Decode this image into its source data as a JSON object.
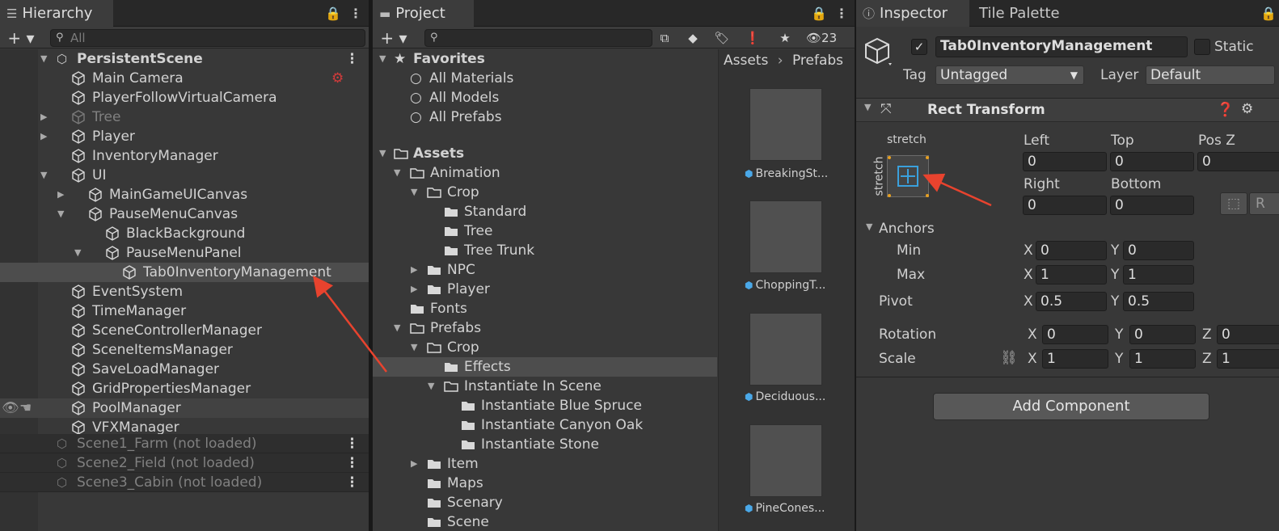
{
  "hierarchy": {
    "tab_label": "Hierarchy",
    "search_placeholder": "All",
    "scene_name": "PersistentScene",
    "items": [
      {
        "label": "Main Camera",
        "depth": 0
      },
      {
        "label": "PlayerFollowVirtualCamera",
        "depth": 0
      },
      {
        "label": "Tree",
        "depth": 0
      },
      {
        "label": "Player",
        "depth": 0
      },
      {
        "label": "InventoryManager",
        "depth": 0
      },
      {
        "label": "UI",
        "depth": 0
      },
      {
        "label": "MainGameUICanvas",
        "depth": 1
      },
      {
        "label": "PauseMenuCanvas",
        "depth": 1
      },
      {
        "label": "BlackBackground",
        "depth": 2
      },
      {
        "label": "PauseMenuPanel",
        "depth": 2
      },
      {
        "label": "Tab0InventoryManagement",
        "depth": 3
      },
      {
        "label": "EventSystem",
        "depth": 0
      },
      {
        "label": "TimeManager",
        "depth": 0
      },
      {
        "label": "SceneControllerManager",
        "depth": 0
      },
      {
        "label": "SceneItemsManager",
        "depth": 0
      },
      {
        "label": "SaveLoadManager",
        "depth": 0
      },
      {
        "label": "GridPropertiesManager",
        "depth": 0
      },
      {
        "label": "PoolManager",
        "depth": 0
      },
      {
        "label": "VFXManager",
        "depth": 0
      }
    ],
    "unloaded_scenes": [
      {
        "label": "Scene1_Farm (not loaded)"
      },
      {
        "label": "Scene2_Field (not loaded)"
      },
      {
        "label": "Scene3_Cabin (not loaded)"
      }
    ]
  },
  "project": {
    "tab_label": "Project",
    "hidden_count": "23",
    "breadcrumb": [
      "Assets",
      "Prefabs"
    ],
    "favorites_label": "Favorites",
    "favorites": [
      {
        "label": "All Materials"
      },
      {
        "label": "All Models"
      },
      {
        "label": "All Prefabs"
      }
    ],
    "assets_label": "Assets",
    "tree": [
      {
        "label": "Animation"
      },
      {
        "label": "Crop"
      },
      {
        "label": "Standard"
      },
      {
        "label": "Tree"
      },
      {
        "label": "Tree Trunk"
      },
      {
        "label": "NPC"
      },
      {
        "label": "Player"
      },
      {
        "label": "Fonts"
      },
      {
        "label": "Prefabs"
      },
      {
        "label": "Crop"
      },
      {
        "label": "Effects"
      },
      {
        "label": "Instantiate In Scene"
      },
      {
        "label": "Instantiate Blue Spruce"
      },
      {
        "label": "Instantiate Canyon Oak"
      },
      {
        "label": "Instantiate Stone"
      },
      {
        "label": "Item"
      },
      {
        "label": "Maps"
      },
      {
        "label": "Scenary"
      },
      {
        "label": "Scene"
      }
    ],
    "thumbnails": [
      {
        "label": "BreakingSt..."
      },
      {
        "label": "ChoppingT..."
      },
      {
        "label": "Deciduous..."
      },
      {
        "label": "PineCones..."
      }
    ]
  },
  "inspector": {
    "tab_label": "Inspector",
    "tab2_label": "Tile Palette",
    "object_name": "Tab0InventoryManagement",
    "static_label": "Static",
    "tag_label": "Tag",
    "tag_value": "Untagged",
    "layer_label": "Layer",
    "layer_value": "Default",
    "component_title": "Rect Transform",
    "anchor_preset_top": "stretch",
    "anchor_preset_side": "stretch",
    "labels": {
      "left": "Left",
      "top": "Top",
      "posz": "Pos Z",
      "right": "Right",
      "bottom": "Bottom",
      "anchors": "Anchors",
      "min": "Min",
      "max": "Max",
      "pivot": "Pivot",
      "rotation": "Rotation",
      "scale": "Scale",
      "x": "X",
      "y": "Y",
      "z": "Z",
      "raw_button": "R"
    },
    "values": {
      "left": "0",
      "top": "0",
      "posz": "0",
      "right": "0",
      "bottom": "0",
      "min_x": "0",
      "min_y": "0",
      "max_x": "1",
      "max_y": "1",
      "pivot_x": "0.5",
      "pivot_y": "0.5",
      "rot_x": "0",
      "rot_y": "0",
      "rot_z": "0",
      "scale_x": "1",
      "scale_y": "1",
      "scale_z": "1"
    },
    "add_component": "Add Component"
  },
  "colors": {
    "panel": "#383838",
    "selection": "#4d4d4d",
    "annotation_arrow": "#e8432e",
    "prefab_icon": "#4aa8e8"
  }
}
